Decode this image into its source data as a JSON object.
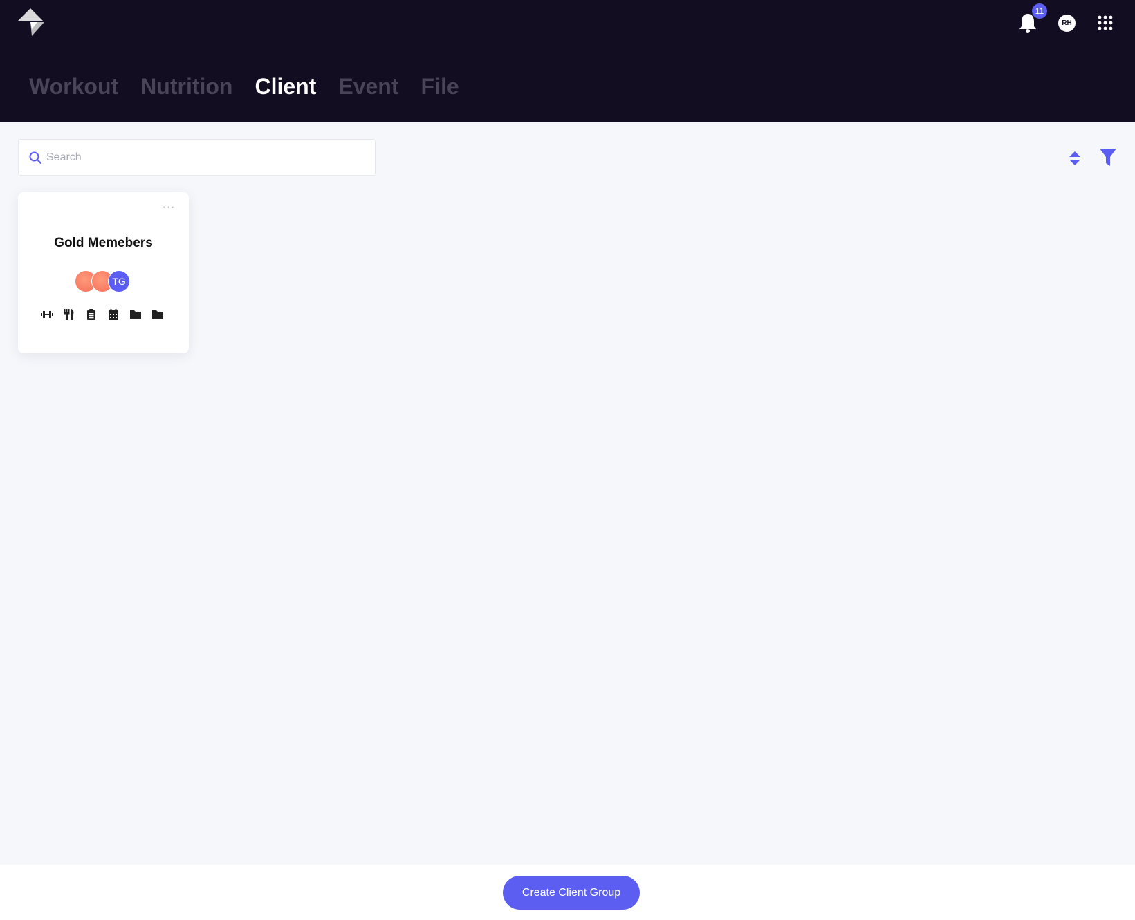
{
  "header": {
    "logo_icon": "app-logo-icon",
    "notifications": {
      "icon": "bell-icon",
      "count": "11"
    },
    "user_avatar": "RH",
    "apps_icon": "grid-icon"
  },
  "tabs": [
    {
      "label": "Workout",
      "active": false
    },
    {
      "label": "Nutrition",
      "active": false
    },
    {
      "label": "Client",
      "active": true
    },
    {
      "label": "Event",
      "active": false
    },
    {
      "label": "File",
      "active": false
    }
  ],
  "search": {
    "placeholder": "Search",
    "value": ""
  },
  "toolbar": {
    "sort_icon": "sort-icon",
    "filter_icon": "filter-icon"
  },
  "groups": [
    {
      "title": "Gold Memebers",
      "more_label": "···",
      "members": [
        {
          "initials": "",
          "color": "#f46e58"
        },
        {
          "initials": "",
          "color": "#f46e58"
        },
        {
          "initials": "TG",
          "color": "#5c5ef2"
        }
      ],
      "icons": [
        "dumbbell-icon",
        "utensils-icon",
        "clipboard-icon",
        "calendar-icon",
        "folder-icon",
        "folder-icon"
      ]
    }
  ],
  "footer": {
    "create_label": "Create Client Group"
  },
  "colors": {
    "header_bg": "#130d22",
    "accent": "#5c5ef2",
    "page_bg": "#f6f7fb"
  }
}
